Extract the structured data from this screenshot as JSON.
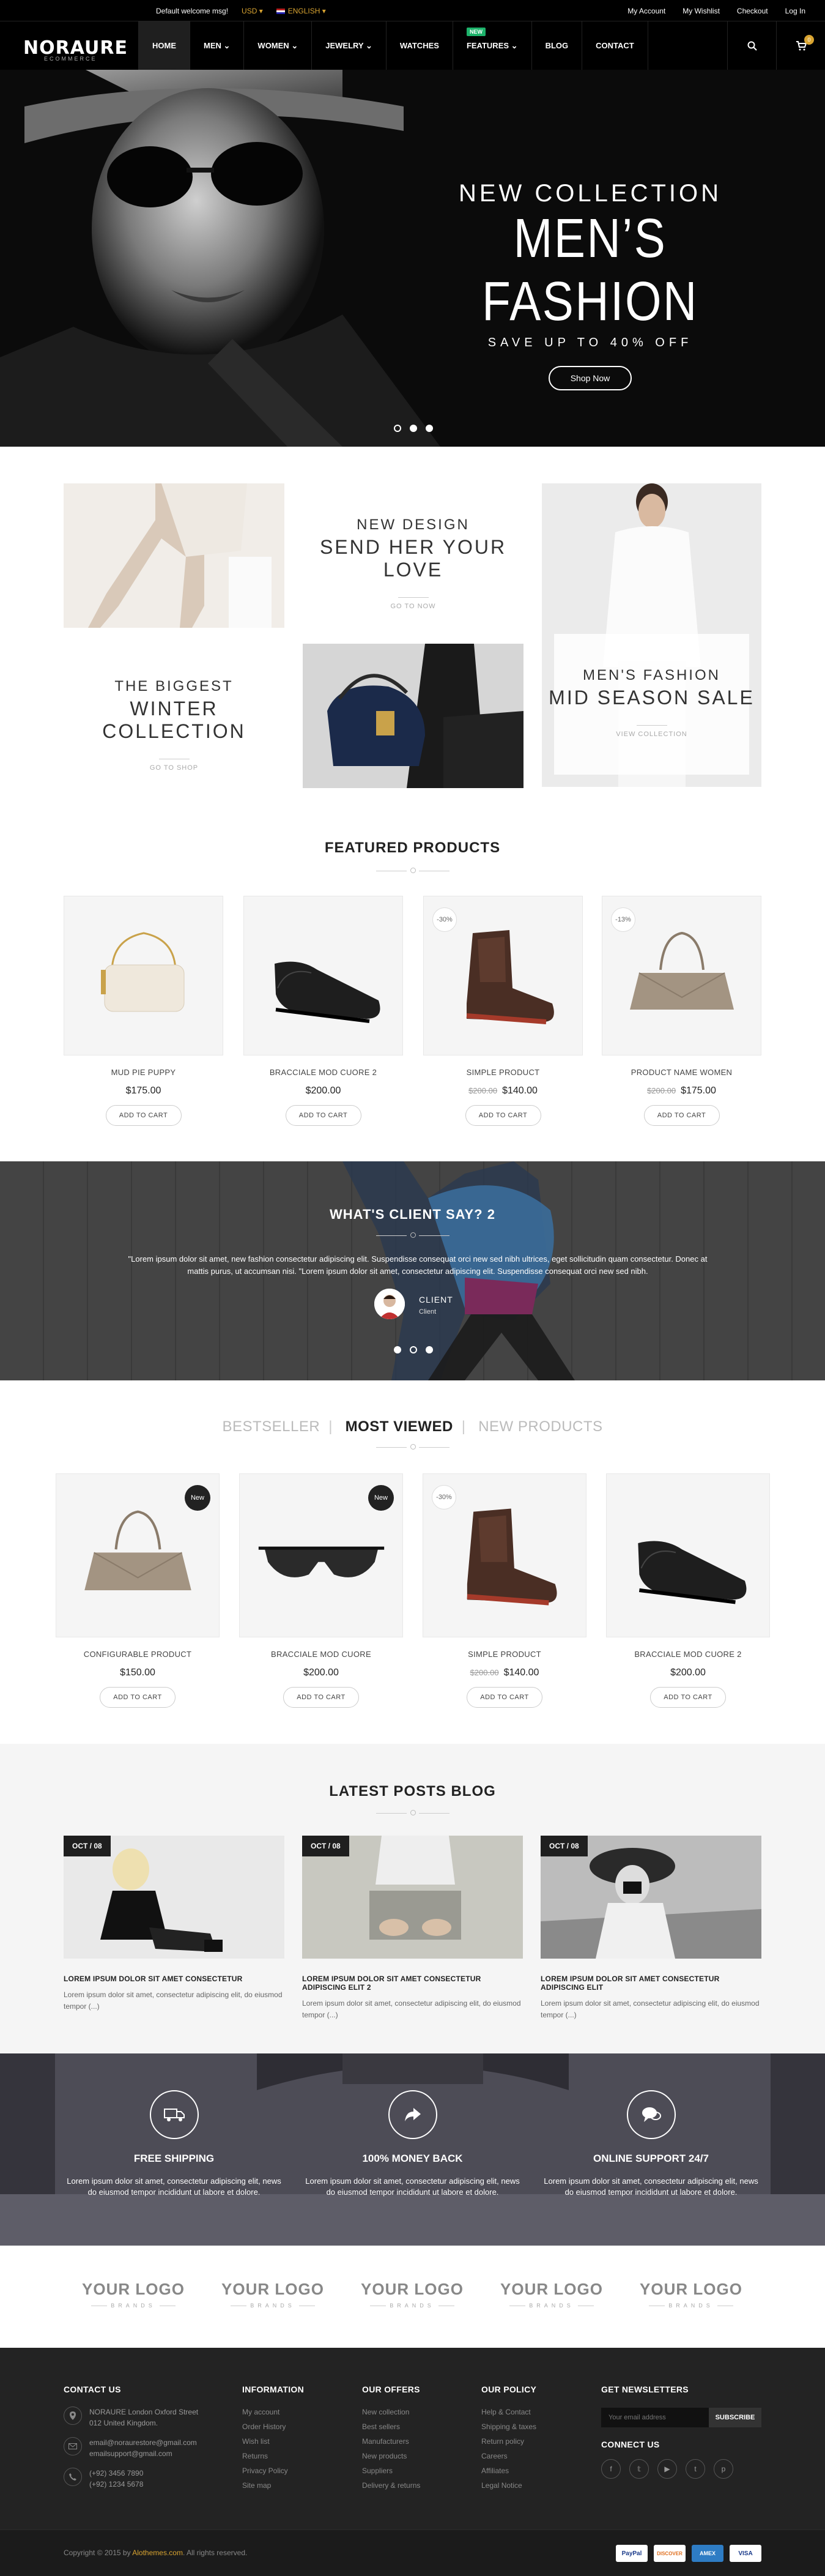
{
  "topbar": {
    "welcome": "Default welcome msg!",
    "currency": "USD",
    "language": "ENGLISH",
    "links": [
      "My Account",
      "My Wishlist",
      "Checkout",
      "Log In"
    ]
  },
  "header": {
    "logo_main": "NORAURE",
    "logo_sub": "ECOMMERCE",
    "nav": [
      {
        "label": "HOME",
        "active": true
      },
      {
        "label": "MEN",
        "dropdown": true
      },
      {
        "label": "WOMEN",
        "dropdown": true
      },
      {
        "label": "JEWELRY",
        "dropdown": true
      },
      {
        "label": "WATCHES"
      },
      {
        "label": "FEATURES",
        "dropdown": true,
        "badge": "NEW"
      },
      {
        "label": "BLOG"
      },
      {
        "label": "CONTACT"
      }
    ],
    "cart_count": "0",
    "icons": [
      "search-icon",
      "cart-icon"
    ]
  },
  "hero": {
    "kicker": "NEW COLLECTION",
    "title": "MEN’S FASHION",
    "subtitle": "SAVE UP TO 40% OFF",
    "button": "Shop Now"
  },
  "banners": {
    "b1": {
      "kicker": "NEW DESIGN",
      "title": "SEND HER YOUR LOVE",
      "link": "GO TO NOW"
    },
    "b2": {
      "kicker": "THE BIGGEST",
      "title": "WINTER COLLECTION",
      "link": "GO TO SHOP"
    },
    "b3": {
      "kicker": "MEN'S FASHION",
      "title": "MID SEASON SALE",
      "link": "VIEW COLLECTION"
    }
  },
  "featured": {
    "title": "FEATURED PRODUCTS",
    "products": [
      {
        "name": "MUD PIE PUPPY",
        "price": "$175.00",
        "old": "",
        "tag": "",
        "button": "ADD TO CART"
      },
      {
        "name": "BRACCIALE MOD CUORE 2",
        "price": "$200.00",
        "old": "",
        "tag": "",
        "button": "ADD TO CART"
      },
      {
        "name": "SIMPLE PRODUCT",
        "price": "$140.00",
        "old": "$200.00",
        "tag": "-30%",
        "button": "ADD TO CART"
      },
      {
        "name": "PRODUCT NAME WOMEN",
        "price": "$175.00",
        "old": "$200.00",
        "tag": "-13%",
        "button": "ADD TO CART"
      }
    ]
  },
  "testimonial": {
    "title": "WHAT'S CLIENT SAY? 2",
    "text": "\"Lorem ipsum dolor sit amet, new fashion consectetur adipiscing elit. Suspendisse consequat orci new sed nibh ultrices, eget sollicitudin quam consectetur. Donec at mattis purus, ut accumsan nisi. \"Lorem ipsum dolor sit amet, consectetur adipiscing elit. Suspendisse consequat orci new sed nibh.",
    "name": "CLIENT",
    "role": "Client"
  },
  "tabs": {
    "items": [
      "BESTSELLER",
      "MOST VIEWED",
      "NEW PRODUCTS"
    ],
    "active": 1,
    "products": [
      {
        "name": "CONFIGURABLE PRODUCT",
        "price": "$150.00",
        "old": "",
        "badge": "New",
        "tag": "",
        "button": "ADD TO CART"
      },
      {
        "name": "BRACCIALE MOD CUORE",
        "price": "$200.00",
        "old": "",
        "badge": "New",
        "tag": "",
        "button": "ADD TO CART"
      },
      {
        "name": "SIMPLE PRODUCT",
        "price": "$140.00",
        "old": "$200.00",
        "badge": "",
        "tag": "-30%",
        "button": "ADD TO CART"
      },
      {
        "name": "BRACCIALE MOD CUORE 2",
        "price": "$200.00",
        "old": "",
        "badge": "",
        "tag": "",
        "button": "ADD TO CART"
      }
    ]
  },
  "blog": {
    "title": "LATEST POSTS BLOG",
    "posts": [
      {
        "date": "OCT / 08",
        "title": "LOREM IPSUM DOLOR SIT AMET CONSECTETUR",
        "excerpt": "Lorem ipsum dolor sit amet, consectetur adipiscing elit, do eiusmod tempor (...)"
      },
      {
        "date": "OCT / 08",
        "title": "LOREM IPSUM DOLOR SIT AMET CONSECTETUR ADIPISCING ELIT 2",
        "excerpt": "Lorem ipsum dolor sit amet, consectetur adipiscing elit, do eiusmod tempor (...)"
      },
      {
        "date": "OCT / 08",
        "title": "LOREM IPSUM DOLOR SIT AMET CONSECTETUR ADIPISCING ELIT",
        "excerpt": "Lorem ipsum dolor sit amet, consectetur adipiscing elit, do eiusmod tempor (...)"
      }
    ]
  },
  "services": [
    {
      "icon": "truck-icon",
      "title": "FREE SHIPPING",
      "text": "Lorem ipsum dolor sit amet, consectetur adipiscing elit, news do eiusmod tempor incididunt ut labore et dolore."
    },
    {
      "icon": "share-arrow-icon",
      "title": "100% MONEY BACK",
      "text": "Lorem ipsum dolor sit amet, consectetur adipiscing elit, news do eiusmod tempor incididunt ut labore et dolore."
    },
    {
      "icon": "chat-icon",
      "title": "ONLINE SUPPORT 24/7",
      "text": "Lorem ipsum dolor sit amet, consectetur adipiscing elit, news do eiusmod tempor incididunt ut labore et dolore."
    }
  ],
  "brands": [
    {
      "name": "YOUR LOGO",
      "sub": "BRANDS"
    },
    {
      "name": "YOUR LOGO",
      "sub": "BRANDS"
    },
    {
      "name": "YOUR LOGO",
      "sub": "BRANDS"
    },
    {
      "name": "YOUR LOGO",
      "sub": "BRANDS"
    },
    {
      "name": "YOUR LOGO",
      "sub": "BRANDS"
    }
  ],
  "footer": {
    "contact_title": "CONTACT US",
    "address": "NORAURE London Oxford Street 012 United Kingdom.",
    "email1": "email@noraurestore@gmail.com",
    "email2": "emailsupport@gmail.com",
    "phone1": "(+92) 3456 7890",
    "phone2": "(+92) 1234 5678",
    "info_title": "INFORMATION",
    "info": [
      "My account",
      "Order History",
      "Wish list",
      "Returns",
      "Privacy Policy",
      "Site map"
    ],
    "offers_title": "OUR OFFERS",
    "offers": [
      "New collection",
      "Best sellers",
      "Manufacturers",
      "New products",
      "Suppliers",
      "Delivery & returns"
    ],
    "policy_title": "OUR POLICY",
    "policy": [
      "Help & Contact",
      "Shipping & taxes",
      "Return policy",
      "Careers",
      "Affiliates",
      "Legal Notice"
    ],
    "newsletter_title": "GET NEWSLETTERS",
    "newsletter_placeholder": "Your email address",
    "newsletter_button": "SUBSCRIBE",
    "connect_title": "CONNECT US",
    "copyright_pre": "Copyright © 2015 by ",
    "copyright_link": "Alothemes.com",
    "copyright_post": ". All rights reserved.",
    "payments": [
      "PayPal",
      "DISCOVER",
      "AMEX",
      "VISA"
    ]
  }
}
